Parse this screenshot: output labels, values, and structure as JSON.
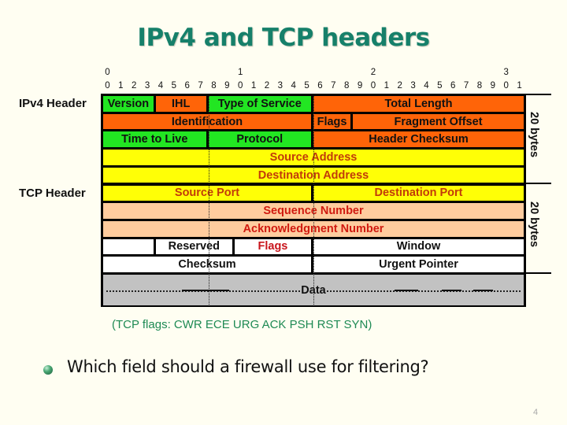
{
  "title": "IPv4 and TCP headers",
  "bit_ruler": {
    "tens": [
      {
        "pos": 0,
        "label": "0"
      },
      {
        "pos": 10,
        "label": "1"
      },
      {
        "pos": 20,
        "label": "2"
      },
      {
        "pos": 30,
        "label": "3"
      }
    ],
    "units": [
      "0",
      "1",
      "2",
      "3",
      "4",
      "5",
      "6",
      "7",
      "8",
      "9",
      "0",
      "1",
      "2",
      "3",
      "4",
      "5",
      "6",
      "7",
      "8",
      "9",
      "0",
      "1",
      "2",
      "3",
      "4",
      "5",
      "6",
      "7",
      "8",
      "9",
      "0",
      "1"
    ]
  },
  "labels": {
    "ipv4_header": "IPv4 Header",
    "tcp_header": "TCP Header",
    "ipv4_size": "20 bytes",
    "tcp_size": "20 bytes"
  },
  "rows": [
    {
      "section": "ipv4",
      "fields": [
        {
          "name": "Version",
          "bits": 4,
          "color": "green"
        },
        {
          "name": "IHL",
          "bits": 4,
          "color": "orange"
        },
        {
          "name": "Type of Service",
          "bits": 8,
          "color": "green"
        },
        {
          "name": "Total Length",
          "bits": 16,
          "color": "orange"
        }
      ]
    },
    {
      "section": "ipv4",
      "fields": [
        {
          "name": "Identification",
          "bits": 16,
          "color": "orange"
        },
        {
          "name": "Flags",
          "bits": 3,
          "color": "orange"
        },
        {
          "name": "Fragment Offset",
          "bits": 13,
          "color": "orange"
        }
      ]
    },
    {
      "section": "ipv4",
      "fields": [
        {
          "name": "Time to Live",
          "bits": 8,
          "color": "green"
        },
        {
          "name": "Protocol",
          "bits": 8,
          "color": "green"
        },
        {
          "name": "Header Checksum",
          "bits": 16,
          "color": "orange"
        }
      ]
    },
    {
      "section": "ipv4",
      "fields": [
        {
          "name": "Source Address",
          "bits": 32,
          "color": "yellow"
        }
      ]
    },
    {
      "section": "ipv4",
      "fields": [
        {
          "name": "Destination Address",
          "bits": 32,
          "color": "yellow"
        }
      ]
    },
    {
      "section": "tcp",
      "fields": [
        {
          "name": "Source Port",
          "bits": 16,
          "color": "yellow"
        },
        {
          "name": "Destination Port",
          "bits": 16,
          "color": "yellow"
        }
      ]
    },
    {
      "section": "tcp",
      "fields": [
        {
          "name": "Sequence Number",
          "bits": 32,
          "color": "peach"
        }
      ]
    },
    {
      "section": "tcp",
      "fields": [
        {
          "name": "Acknowledgment Number",
          "bits": 32,
          "color": "peach"
        }
      ]
    },
    {
      "section": "tcp",
      "fields": [
        {
          "name": "",
          "bits": 4,
          "color": "white"
        },
        {
          "name": "Reserved",
          "bits": 6,
          "color": "white"
        },
        {
          "name": "Flags",
          "bits": 6,
          "color": "white",
          "text_color": "red"
        },
        {
          "name": "Window",
          "bits": 16,
          "color": "white"
        }
      ]
    },
    {
      "section": "tcp",
      "fields": [
        {
          "name": "Checksum",
          "bits": 16,
          "color": "white"
        },
        {
          "name": "Urgent Pointer",
          "bits": 16,
          "color": "white"
        }
      ]
    },
    {
      "section": "data",
      "tall": true,
      "fields": [
        {
          "name": "Data",
          "bits": 32,
          "color": "gray"
        }
      ]
    }
  ],
  "flags_note": "(TCP flags: CWR ECE URG ACK PSH RST SYN)",
  "bullet_question": "Which field should a firewall use for filtering?",
  "page_number": "4",
  "colors": {
    "title": "#16806a",
    "green": "#22e622",
    "orange": "#ff6408",
    "yellow": "#ffff06",
    "peach": "#ffcc9e",
    "white": "#ffffff",
    "gray": "#c2c2c2",
    "note": "#1e8a54"
  }
}
